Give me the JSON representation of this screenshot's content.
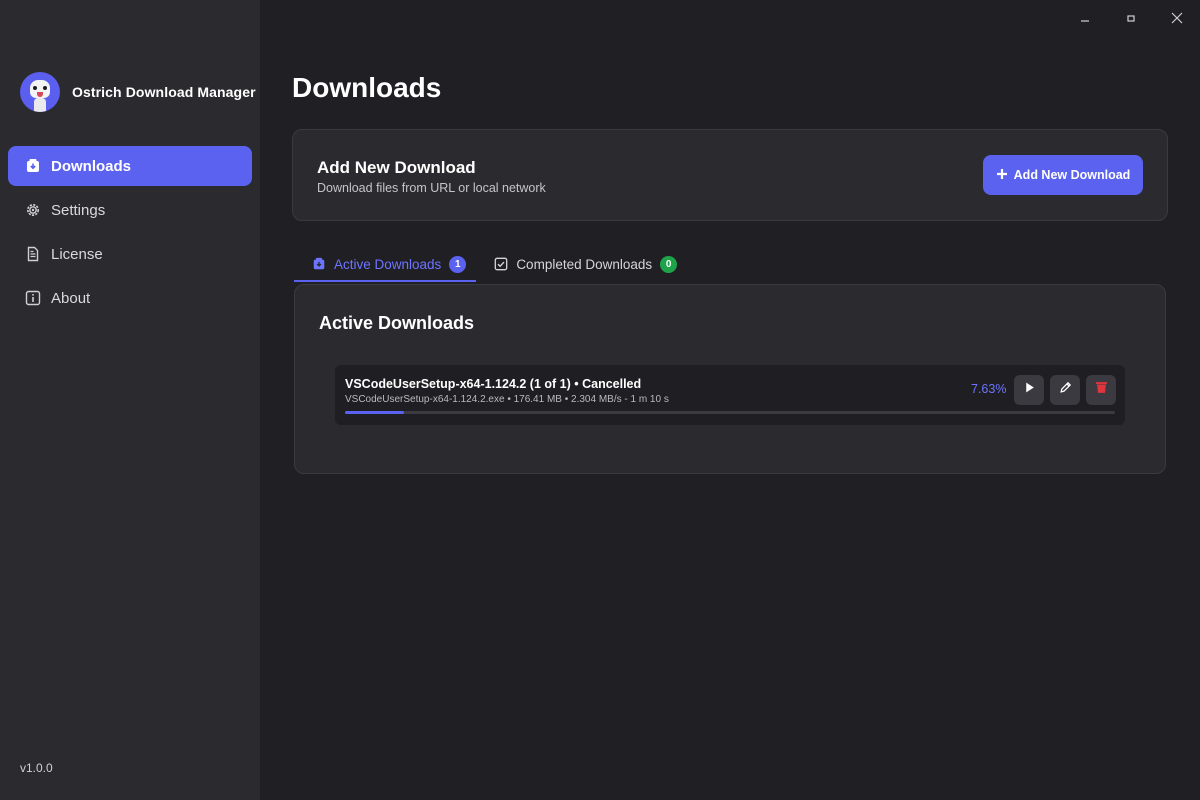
{
  "app": {
    "name": "Ostrich Download Manager",
    "version": "v1.0.0"
  },
  "window_controls": [
    {
      "name": "minimize",
      "icon": "minimize-icon"
    },
    {
      "name": "maximize",
      "icon": "maximize-icon"
    },
    {
      "name": "close",
      "icon": "close-icon"
    }
  ],
  "sidebar": {
    "items": [
      {
        "label": "Downloads",
        "icon": "download-box-icon",
        "active": true
      },
      {
        "label": "Settings",
        "icon": "gear-icon",
        "active": false
      },
      {
        "label": "License",
        "icon": "document-icon",
        "active": false
      },
      {
        "label": "About",
        "icon": "info-icon",
        "active": false
      }
    ]
  },
  "main": {
    "title": "Downloads",
    "add_card": {
      "title": "Add New Download",
      "subtitle": "Download files from URL or local network",
      "button_label": "Add New Download",
      "button_icon": "plus-icon"
    },
    "tabs": [
      {
        "label": "Active Downloads",
        "count": "1",
        "icon": "download-box-icon",
        "active": true
      },
      {
        "label": "Completed Downloads",
        "count": "0",
        "icon": "checkbox-icon",
        "active": false
      }
    ],
    "list": {
      "title": "Active Downloads",
      "items": [
        {
          "title": "VSCodeUserSetup-x64-1.124.2 (1 of 1) • Cancelled",
          "meta": "VSCodeUserSetup-x64-1.124.2.exe • 176.41 MB • 2.304 MB/s - 1 m 10 s",
          "percent_label": "7.63%",
          "progress": 0.0763,
          "actions": [
            "play-icon",
            "pencil-icon",
            "trash-icon"
          ]
        }
      ]
    }
  },
  "colors": {
    "accent": "#5b62f0",
    "accent_text": "#6d74ff",
    "success": "#1fa34a",
    "danger": "#e0343f",
    "sidebar_bg": "#2b2b2f",
    "content_bg": "#202024"
  }
}
